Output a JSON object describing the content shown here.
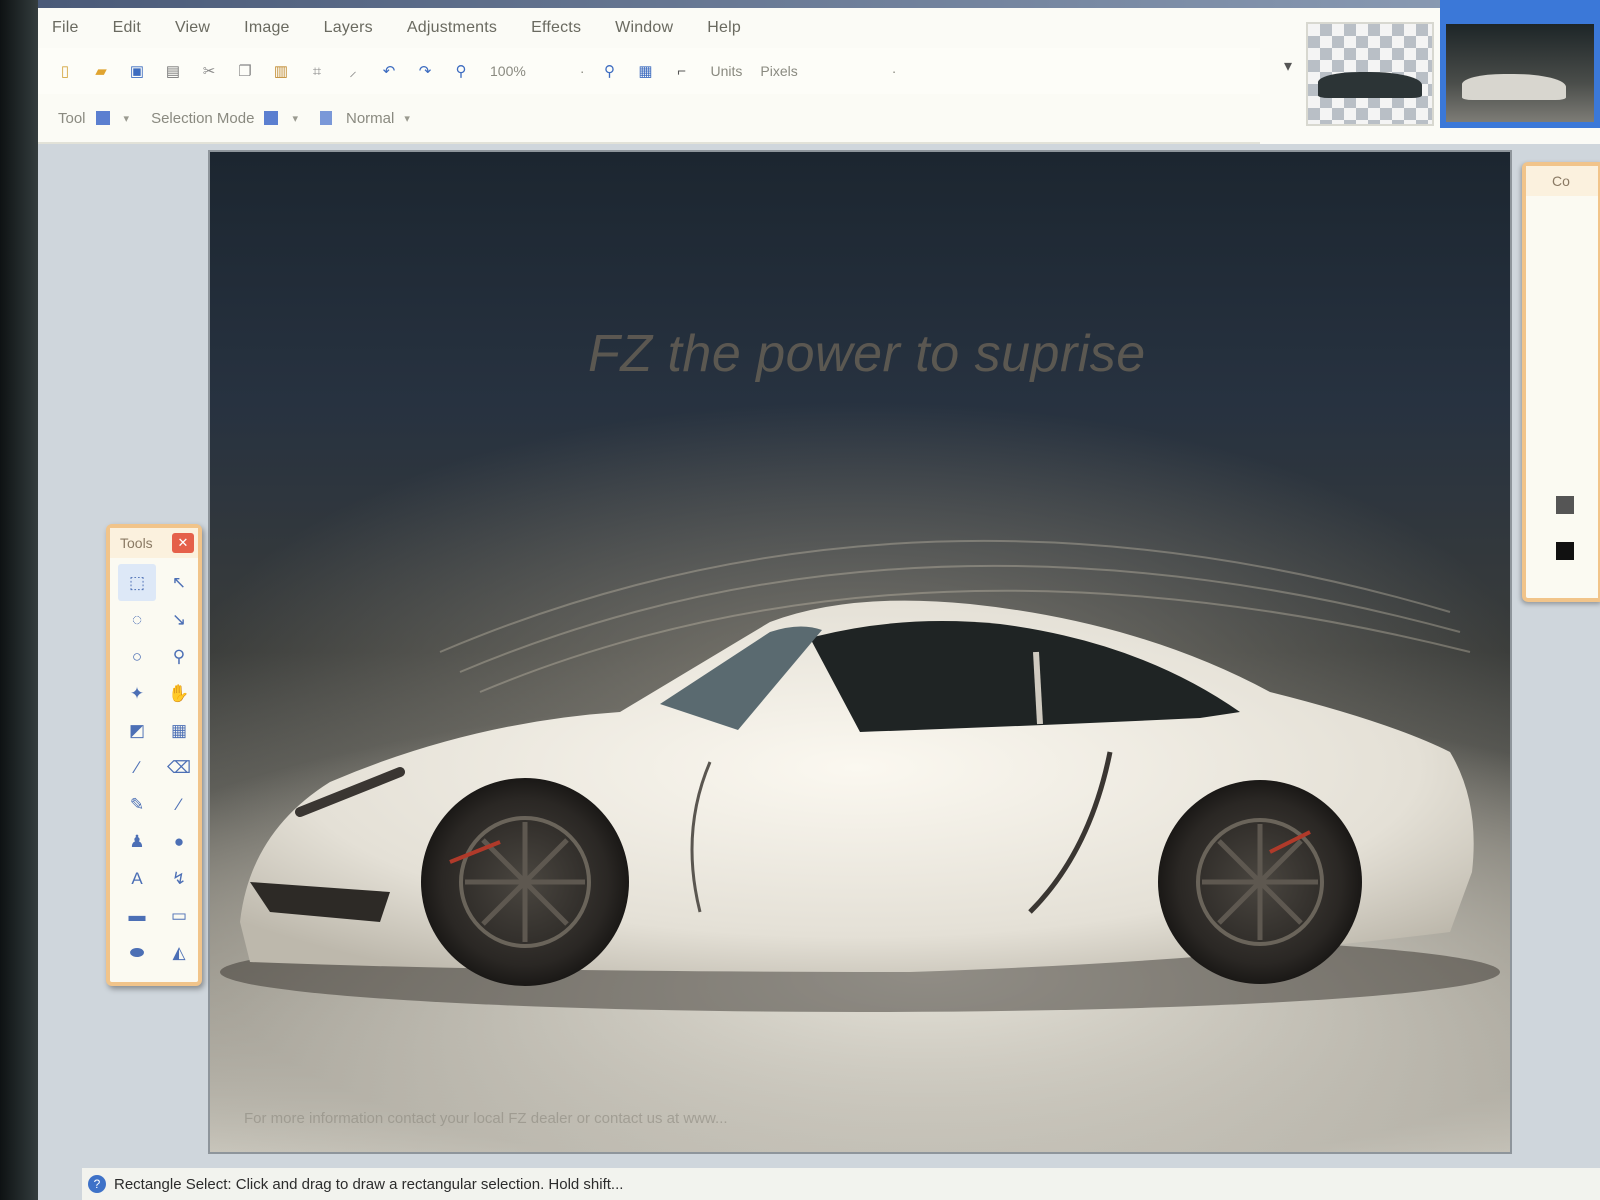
{
  "menu": {
    "items": [
      "File",
      "Edit",
      "View",
      "Image",
      "Layers",
      "Adjustments",
      "Effects",
      "Window",
      "Help"
    ]
  },
  "toolbar": {
    "zoom_value": "100%",
    "units_label": "Units",
    "units_value": "Pixels"
  },
  "tool_options": {
    "tool_label": "Tool",
    "selection_mode_label": "Selection Mode",
    "blend_mode": "Normal"
  },
  "canvas": {
    "tagline": "FZ the power to suprise",
    "footer": "For more information contact your local FZ dealer or contact us at www..."
  },
  "tools_window": {
    "title": "Tools",
    "close_glyph": "✕",
    "tools": [
      {
        "name": "rectangle-select",
        "glyph": "⬚"
      },
      {
        "name": "move-selection",
        "glyph": "↖"
      },
      {
        "name": "lasso-select",
        "glyph": "◌"
      },
      {
        "name": "move-selected",
        "glyph": "↘"
      },
      {
        "name": "ellipse-select",
        "glyph": "○"
      },
      {
        "name": "zoom",
        "glyph": "⚲"
      },
      {
        "name": "magic-wand",
        "glyph": "✦"
      },
      {
        "name": "pan",
        "glyph": "✋"
      },
      {
        "name": "paint-bucket",
        "glyph": "◩"
      },
      {
        "name": "gradient",
        "glyph": "▦"
      },
      {
        "name": "paintbrush",
        "glyph": "∕"
      },
      {
        "name": "eraser",
        "glyph": "⌫"
      },
      {
        "name": "pencil",
        "glyph": "✎"
      },
      {
        "name": "color-picker",
        "glyph": "⁄"
      },
      {
        "name": "clone-stamp",
        "glyph": "♟"
      },
      {
        "name": "recolor",
        "glyph": "●"
      },
      {
        "name": "text",
        "glyph": "A"
      },
      {
        "name": "line-curve",
        "glyph": "↯"
      },
      {
        "name": "rectangle",
        "glyph": "▬"
      },
      {
        "name": "rounded-rectangle",
        "glyph": "▭"
      },
      {
        "name": "ellipse",
        "glyph": "⬬"
      },
      {
        "name": "freeform-shape",
        "glyph": "◭"
      }
    ]
  },
  "right_panel": {
    "title": "Co"
  },
  "status": {
    "icon_glyph": "?",
    "text": "Rectangle Select: Click and drag to draw a rectangular selection. Hold shift..."
  },
  "colors": {
    "panel_border": "#f1c48a",
    "accent_blue": "#3b78d8",
    "close_red": "#e5604a"
  }
}
